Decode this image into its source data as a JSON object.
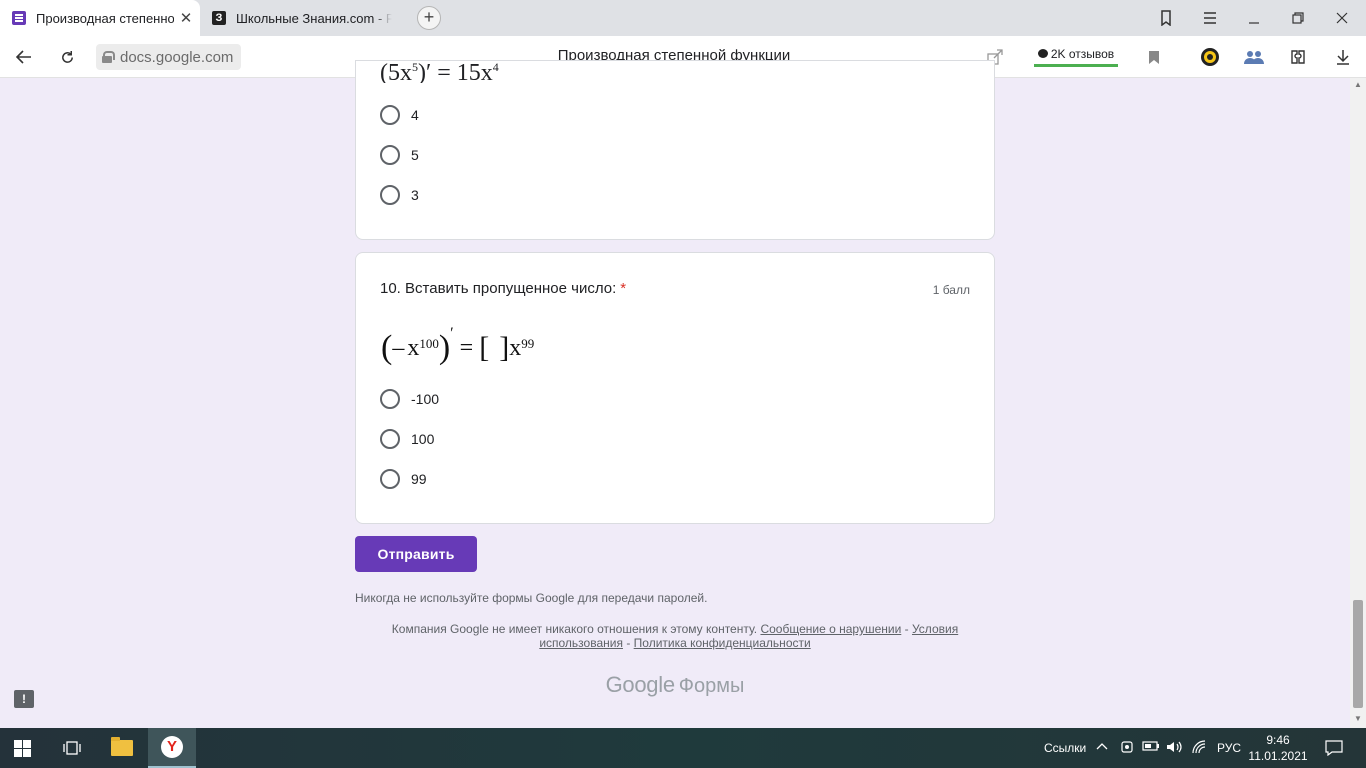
{
  "browser": {
    "tabs": [
      {
        "title": "Производная степенной функции",
        "close": "✕"
      },
      {
        "title": "Школьные Знания.com - Р"
      }
    ],
    "address": {
      "domain": "docs.google.com"
    },
    "page_title": "Производная степенной функции",
    "reviews_label": "2K отзывов"
  },
  "form": {
    "prev_question": {
      "options": [
        "4",
        "5",
        "3"
      ]
    },
    "question10": {
      "number_title": "10. Вставить пропущенное число:",
      "required_mark": "*",
      "points": "1 балл",
      "formula": {
        "minus": "–",
        "var": "x",
        "exp": "100",
        "equals": "=",
        "result_var": "x",
        "result_exp": "99"
      },
      "options": [
        "-100",
        "100",
        "99"
      ]
    },
    "submit_label": "Отправить",
    "notice": "Никогда не используйте формы Google для передачи паролей.",
    "footer": {
      "text": "Компания Google не имеет никакого отношения к этому контенту.",
      "report_link": "Сообщение о нарушении",
      "sep1": "-",
      "terms_link": "Условия использования",
      "sep2": "-",
      "privacy_link": "Политика конфиденциальности"
    },
    "brand": {
      "google": "Google",
      "forms": "Формы"
    }
  },
  "taskbar": {
    "links_label": "Ссылки",
    "language": "РУС",
    "time": "9:46",
    "date": "11.01.2021"
  }
}
